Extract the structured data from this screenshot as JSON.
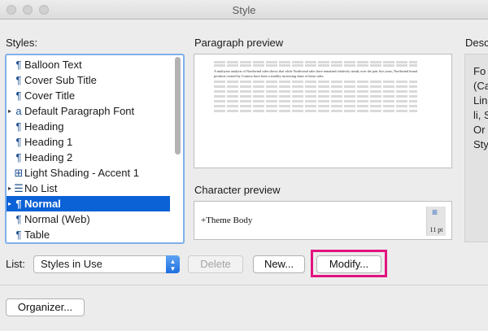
{
  "window": {
    "title": "Style"
  },
  "labels": {
    "styles": "Styles:",
    "paragraph_preview": "Paragraph preview",
    "character_preview": "Character preview",
    "description": "Desc",
    "list": "List:"
  },
  "styles_list": [
    {
      "label": "Balloon Text",
      "icon": "paragraph-mark-icon",
      "expand": false,
      "selected": false
    },
    {
      "label": "Cover Sub Title",
      "icon": "paragraph-mark-icon",
      "expand": false,
      "selected": false
    },
    {
      "label": "Cover Title",
      "icon": "paragraph-mark-icon",
      "expand": false,
      "selected": false
    },
    {
      "label": "Default Paragraph Font",
      "icon": "character-style-icon",
      "expand": true,
      "selected": false
    },
    {
      "label": "Heading",
      "icon": "paragraph-mark-icon",
      "expand": false,
      "selected": false
    },
    {
      "label": "Heading 1",
      "icon": "paragraph-mark-icon",
      "expand": false,
      "selected": false
    },
    {
      "label": "Heading 2",
      "icon": "paragraph-mark-icon",
      "expand": false,
      "selected": false
    },
    {
      "label": "Light Shading - Accent 1",
      "icon": "table-style-icon",
      "expand": false,
      "selected": false
    },
    {
      "label": "No List",
      "icon": "list-style-icon",
      "expand": true,
      "selected": false
    },
    {
      "label": "Normal",
      "icon": "paragraph-mark-icon",
      "expand": true,
      "selected": true
    },
    {
      "label": "Normal (Web)",
      "icon": "paragraph-mark-icon",
      "expand": false,
      "selected": false
    },
    {
      "label": "Table",
      "icon": "paragraph-mark-icon",
      "expand": false,
      "selected": false
    }
  ],
  "paragraph_preview": {
    "sample_text": "A multiyear analysis of Northwind sales shows that while Northwind sales have remained relatively steady over the past five years, Northwind brand products created by Contoso have been a steadily increasing share of those sales."
  },
  "character_preview": {
    "sample_text": "+Theme Body",
    "size": "11 pt"
  },
  "description": {
    "lines": [
      "Fo",
      "(Ca",
      "Lin",
      "li, S",
      "Or",
      "Sty"
    ]
  },
  "controls": {
    "list_value": "Styles in Use",
    "delete_label": "Delete",
    "new_label": "New...",
    "modify_label": "Modify...",
    "organizer_label": "Organizer..."
  },
  "colors": {
    "selection": "#0b61d6",
    "focus_ring": "#7fb0ea",
    "highlight": "#e2137f"
  }
}
